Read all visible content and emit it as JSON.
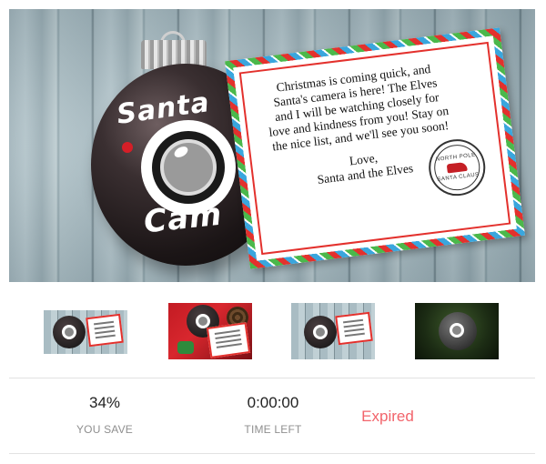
{
  "hero": {
    "ornament_top_text": "Santa",
    "ornament_bottom_text": "Cam",
    "card_message": "Christmas is coming quick, and Santa's camera is here! The Elves and I will be watching closely for love and kindness from you! Stay on the nice list, and we'll see you soon!",
    "card_signoff_1": "Love,",
    "card_signoff_2": "Santa and the Elves",
    "stamp_top": "NORTH POLE",
    "stamp_bottom": "SANTA CLAUS"
  },
  "thumbnails": [
    {
      "alt": "Santa Cam ornament with note on wood"
    },
    {
      "alt": "Santa Cam ornament with elf and pinecone"
    },
    {
      "alt": "Santa Cam ornament with note"
    },
    {
      "alt": "Santa Cam ornament in tree"
    }
  ],
  "stats": {
    "you_save_value": "34%",
    "you_save_label": "YOU SAVE",
    "time_left_value": "0:00:00",
    "time_left_label": "TIME LEFT",
    "status": "Expired"
  },
  "colors": {
    "expired": "#f2646b",
    "label": "#8f8f8f",
    "divider": "#e2e2e2"
  }
}
